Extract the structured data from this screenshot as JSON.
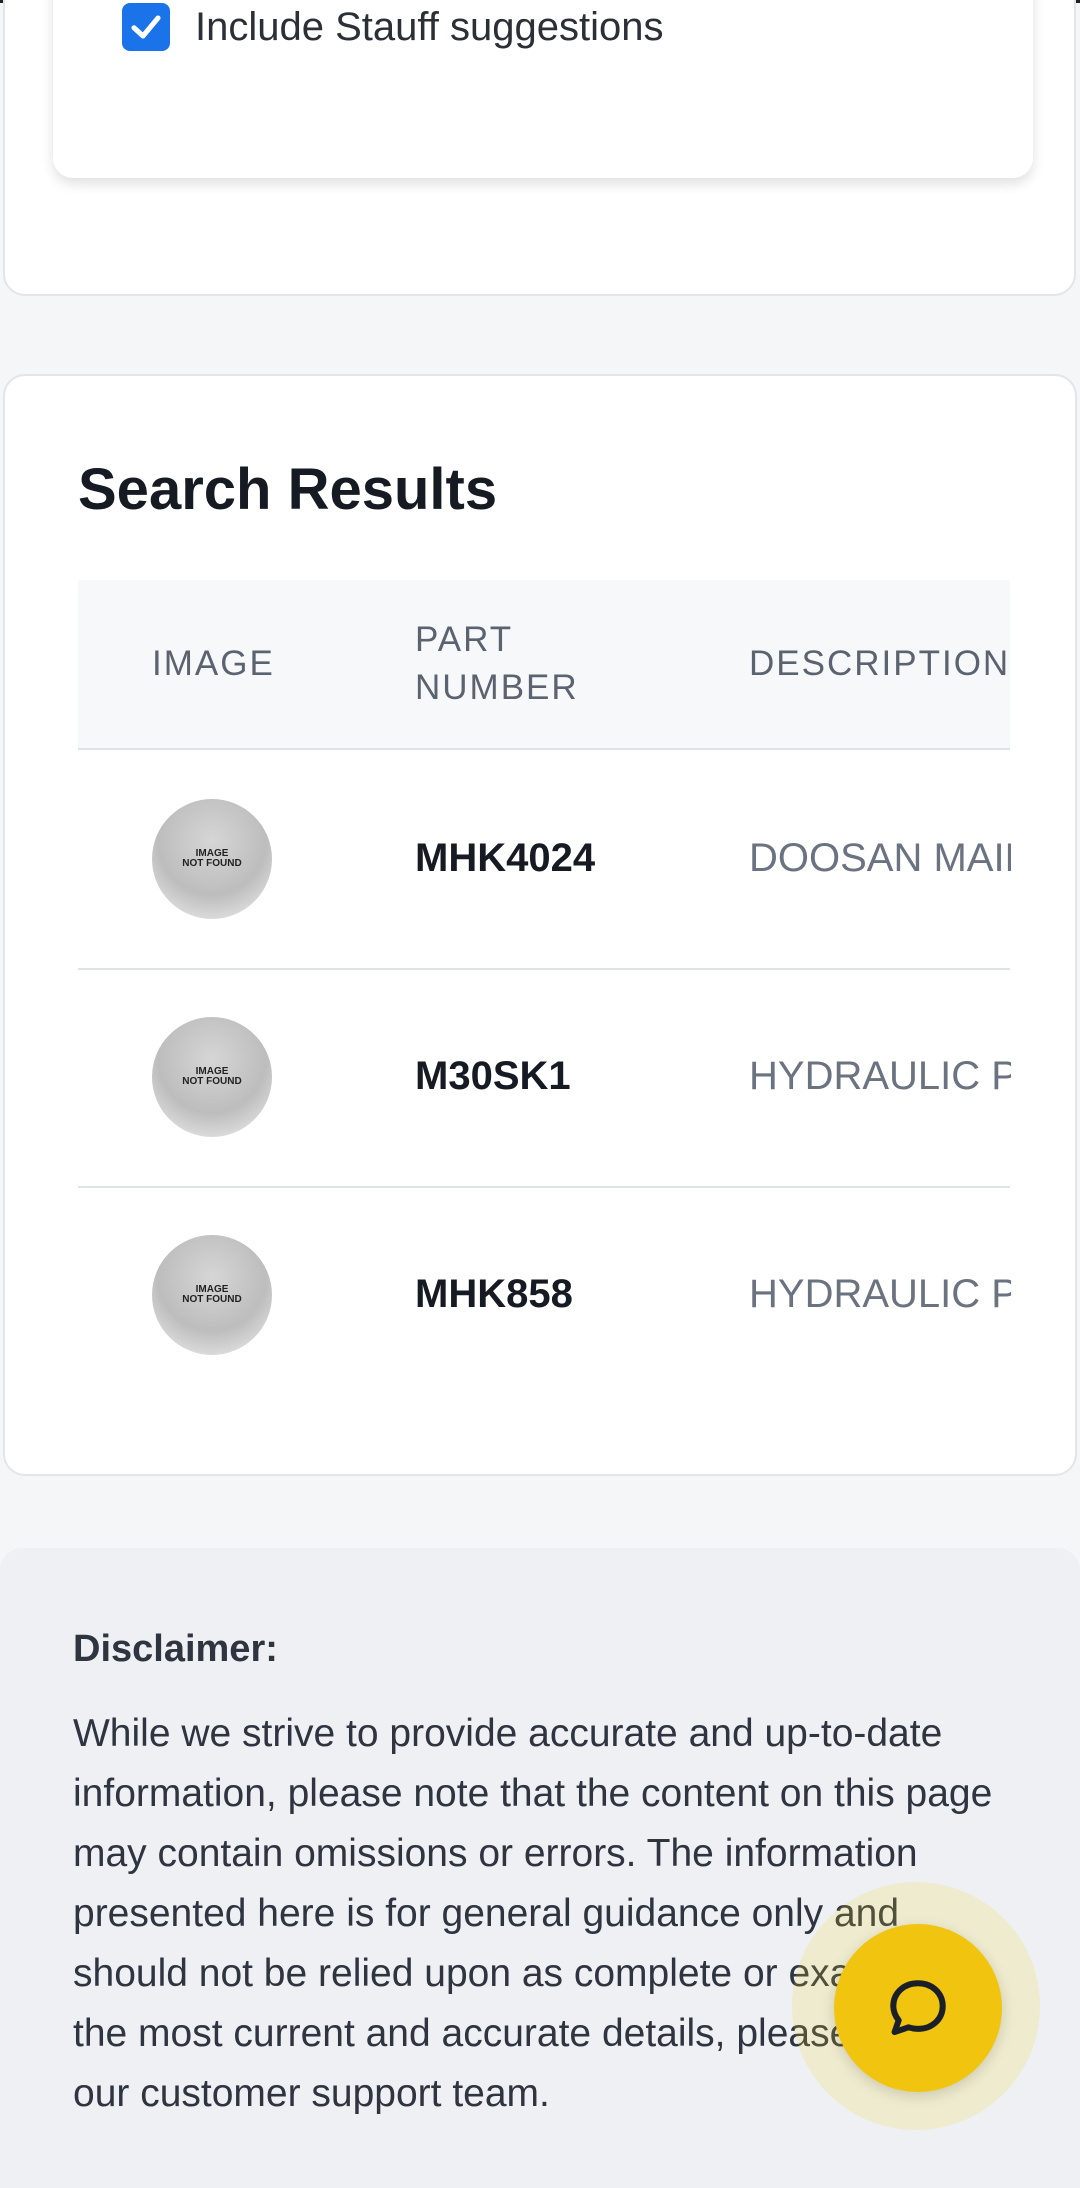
{
  "filters": {
    "stauff_label": "Include Stauff suggestions",
    "stauff_checked": true
  },
  "results": {
    "title": "Search Results",
    "columns": {
      "image": "IMAGE",
      "part_line1": "PART",
      "part_line2": "NUMBER",
      "description": "DESCRIPTION"
    },
    "placeholder_line1": "IMAGE",
    "placeholder_line2": "NOT FOUND",
    "rows": [
      {
        "part_number": "MHK4024",
        "description": "DOOSAN MAIN"
      },
      {
        "part_number": "M30SK1",
        "description": "HYDRAULIC P"
      },
      {
        "part_number": "MHK858",
        "description": "HYDRAULIC P"
      }
    ]
  },
  "disclaimer": {
    "title": "Disclaimer:",
    "body": "While we strive to provide accurate and up-to-date information, please note that the content on this page may contain omissions or errors. The information presented here is for general guidance only and should not be relied upon as complete or exact. For the most current and accurate details, please contact our customer support team."
  },
  "chat": {
    "icon": "chat-bubble-icon",
    "color": "#f1c40f"
  },
  "colors": {
    "accent": "#1a73e8",
    "chat": "#f1c40f"
  }
}
